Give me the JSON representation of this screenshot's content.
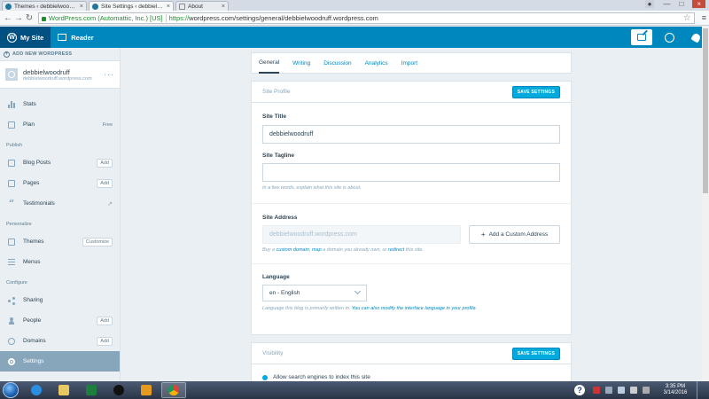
{
  "browser": {
    "tabs": [
      {
        "title": "Themes ‹ debbielwoodruff",
        "active": false
      },
      {
        "title": "Site Settings ‹ debbielwoodruff",
        "active": true
      },
      {
        "title": "About",
        "active": false
      }
    ],
    "secure_label": "WordPress.com (Automattic, Inc.) [US]",
    "url_scheme": "https://",
    "url_rest": "wordpress.com/settings/general/debbielwoodruff.wordpress.com"
  },
  "masterbar": {
    "my_site": "My Site",
    "reader": "Reader"
  },
  "sidebar": {
    "add_new": "ADD NEW WORDPRESS",
    "site_name": "debbielwoodruff",
    "site_domain": "debbielwoodruff.wordpress.com",
    "more": "···",
    "items_top": [
      {
        "label": "Stats",
        "pill": "",
        "free": ""
      },
      {
        "label": "Plan",
        "pill": "",
        "free": "Free"
      }
    ],
    "publish_heading": "Publish",
    "publish_items": [
      {
        "label": "Blog Posts",
        "pill": "Add"
      },
      {
        "label": "Pages",
        "pill": "Add"
      },
      {
        "label": "Testimonials",
        "pill": ""
      }
    ],
    "personalize_heading": "Personalize",
    "personalize_items": [
      {
        "label": "Themes",
        "pill": "Customize"
      },
      {
        "label": "Menus",
        "pill": ""
      }
    ],
    "configure_heading": "Configure",
    "configure_items": [
      {
        "label": "Sharing",
        "pill": ""
      },
      {
        "label": "People",
        "pill": "Add"
      },
      {
        "label": "Domains",
        "pill": "Add"
      },
      {
        "label": "Settings",
        "pill": ""
      }
    ]
  },
  "section_nav": {
    "tabs": [
      "General",
      "Writing",
      "Discussion",
      "Analytics",
      "Import"
    ],
    "current": "General"
  },
  "site_profile": {
    "header": "Site Profile",
    "save_label": "SAVE SETTINGS",
    "title_label": "Site Title",
    "title_value": "debbielwoodruff",
    "tagline_label": "Site Tagline",
    "tagline_value": "",
    "tagline_help": "In a few words, explain what this site is about.",
    "address_label": "Site Address",
    "address_value": "debbielwoodruff.wordpress.com",
    "add_address_label": "Add a Custom Address",
    "address_help_pre": "Buy a ",
    "address_help_link1": "custom domain",
    "address_help_mid1": ", ",
    "address_help_link2": "map",
    "address_help_mid2": " a domain you already own, or ",
    "address_help_link3": "redirect",
    "address_help_post": " this site.",
    "language_label": "Language",
    "language_value": "en - English",
    "language_help_pre": "Language this blog is primarily written in. ",
    "language_help_link": "You can also modify the interface language in your profile."
  },
  "visibility": {
    "header": "Visibility",
    "save_label": "SAVE SETTINGS",
    "option_label": "Allow search engines to index this site"
  },
  "taskbar": {
    "time": "3:35 PM",
    "date": "3/14/2016",
    "help": "?"
  },
  "colors": {
    "masterbar": "#0087be",
    "accent": "#00aadc",
    "sidebar_bg": "#e9eff3",
    "selected": "#87a6bc"
  }
}
